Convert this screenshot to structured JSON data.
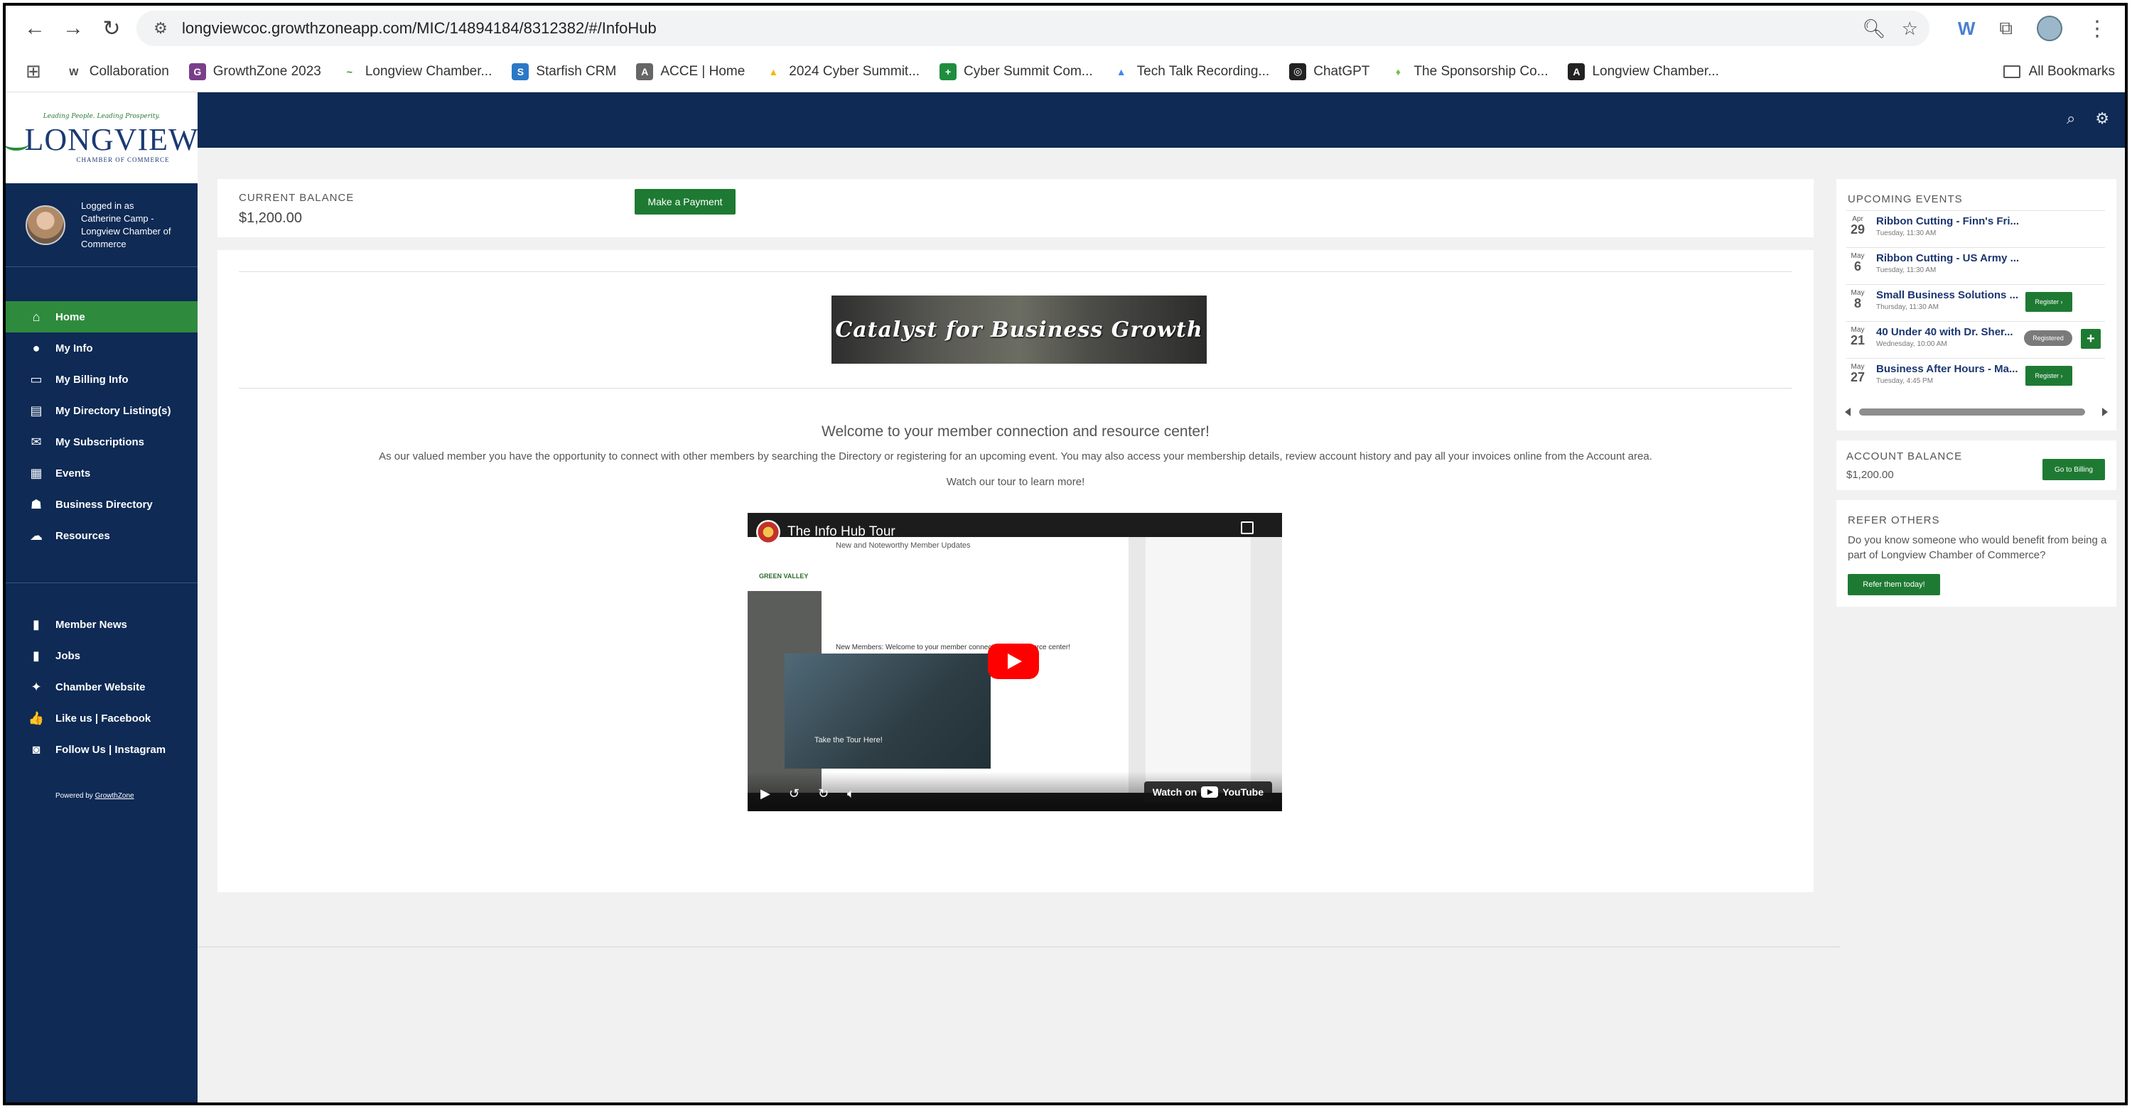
{
  "browser": {
    "url": "longviewcoc.growthzoneapp.com/MIC/14894184/8312382/#/InfoHub",
    "bookmarks": [
      {
        "label": "Collaboration",
        "icon": "W",
        "color": "#ffffff",
        "fg": "#444"
      },
      {
        "label": "GrowthZone 2023",
        "icon": "G",
        "color": "#7a3e8a",
        "fg": "#fff"
      },
      {
        "label": "Longview Chamber...",
        "icon": "~",
        "color": "#ffffff",
        "fg": "#2e8b3e"
      },
      {
        "label": "Starfish CRM",
        "icon": "S",
        "color": "#2a78c8",
        "fg": "#fff"
      },
      {
        "label": "ACCE | Home",
        "icon": "A",
        "color": "#666666",
        "fg": "#fff"
      },
      {
        "label": "2024 Cyber Summit...",
        "icon": "▲",
        "color": "#ffffff",
        "fg": "#f2b900"
      },
      {
        "label": "Cyber Summit Com...",
        "icon": "+",
        "color": "#1e8e3e",
        "fg": "#fff"
      },
      {
        "label": "Tech Talk Recording...",
        "icon": "▲",
        "color": "#ffffff",
        "fg": "#4285f4"
      },
      {
        "label": "ChatGPT",
        "icon": "◎",
        "color": "#222222",
        "fg": "#fff"
      },
      {
        "label": "The Sponsorship Co...",
        "icon": "♦",
        "color": "#ffffff",
        "fg": "#7dbd4a"
      },
      {
        "label": "Longview Chamber...",
        "icon": "A",
        "color": "#222222",
        "fg": "#fff"
      }
    ],
    "all_bookmarks": "All Bookmarks"
  },
  "logo": {
    "tagline": "Leading People. Leading Prosperity.",
    "name": "LONGVIEW",
    "sub": "CHAMBER OF COMMERCE"
  },
  "user": {
    "logged_in_text": "Logged in as Catherine Camp - Longview Chamber of Commerce"
  },
  "nav": {
    "primary": [
      {
        "label": "Home",
        "icon": "⌂",
        "name": "home"
      },
      {
        "label": "My Info",
        "icon": "●",
        "name": "my-info"
      },
      {
        "label": "My Billing Info",
        "icon": "▭",
        "name": "my-billing-info"
      },
      {
        "label": "My Directory Listing(s)",
        "icon": "▤",
        "name": "my-directory-listings"
      },
      {
        "label": "My Subscriptions",
        "icon": "✉",
        "name": "my-subscriptions"
      },
      {
        "label": "Events",
        "icon": "▦",
        "name": "events"
      },
      {
        "label": "Business Directory",
        "icon": "☗",
        "name": "business-directory"
      },
      {
        "label": "Resources",
        "icon": "☁",
        "name": "resources"
      }
    ],
    "secondary": [
      {
        "label": "Member News",
        "icon": "▮",
        "name": "member-news"
      },
      {
        "label": "Jobs",
        "icon": "▮",
        "name": "jobs"
      },
      {
        "label": "Chamber Website",
        "icon": "✦",
        "name": "chamber-website"
      },
      {
        "label": "Like us | Facebook",
        "icon": "👍",
        "name": "like-us-facebook"
      },
      {
        "label": "Follow Us | Instagram",
        "icon": "◙",
        "name": "follow-us-instagram"
      }
    ],
    "powered_prefix": "Powered by",
    "powered_link": "GrowthZone"
  },
  "balance": {
    "label": "CURRENT BALANCE",
    "value": "$1,200.00",
    "button": "Make a Payment"
  },
  "main": {
    "banner_text": "Catalyst for Business Growth",
    "welcome_title": "Welcome to your member connection and resource center!",
    "welcome_text": "As our valued member you have the opportunity to connect with other members by searching the Directory or registering for an upcoming event. You may also access your membership details, review account history and pay all your invoices online from the Account area.",
    "tour_text": "Watch our tour to learn more!",
    "video": {
      "title": "The Info Hub Tour",
      "watch_on": "Watch on",
      "youtube": "YouTube",
      "inner_heading": "New and Noteworthy Member Updates",
      "inner_welcome": "New Members: Welcome to your member connection and resource center!",
      "inner_tour": "Take the Tour Here!",
      "inner_org": "GREEN VALLEY"
    }
  },
  "events": {
    "title": "UPCOMING EVENTS",
    "items": [
      {
        "month": "Apr",
        "day": "29",
        "name": "Ribbon Cutting - Finn's Fri...",
        "time": "Tuesday, 11:30 AM",
        "action": ""
      },
      {
        "month": "May",
        "day": "6",
        "name": "Ribbon Cutting - US Army ...",
        "time": "Tuesday, 11:30 AM",
        "action": ""
      },
      {
        "month": "May",
        "day": "8",
        "name": "Small Business Solutions ...",
        "time": "Thursday, 11:30 AM",
        "action": "Register ›"
      },
      {
        "month": "May",
        "day": "21",
        "name": "40 Under 40 with Dr. Sher...",
        "time": "Wednesday, 10:00 AM",
        "action": "Registered"
      },
      {
        "month": "May",
        "day": "27",
        "name": "Business After Hours - Ma...",
        "time": "Tuesday, 4:45 PM",
        "action": "Register ›"
      }
    ]
  },
  "account": {
    "title": "ACCOUNT BALANCE",
    "value": "$1,200.00",
    "button": "Go to Billing"
  },
  "refer": {
    "title": "REFER OTHERS",
    "text": "Do you know someone who would benefit from being a part of Longview Chamber of Commerce?",
    "button": "Refer them today!"
  }
}
